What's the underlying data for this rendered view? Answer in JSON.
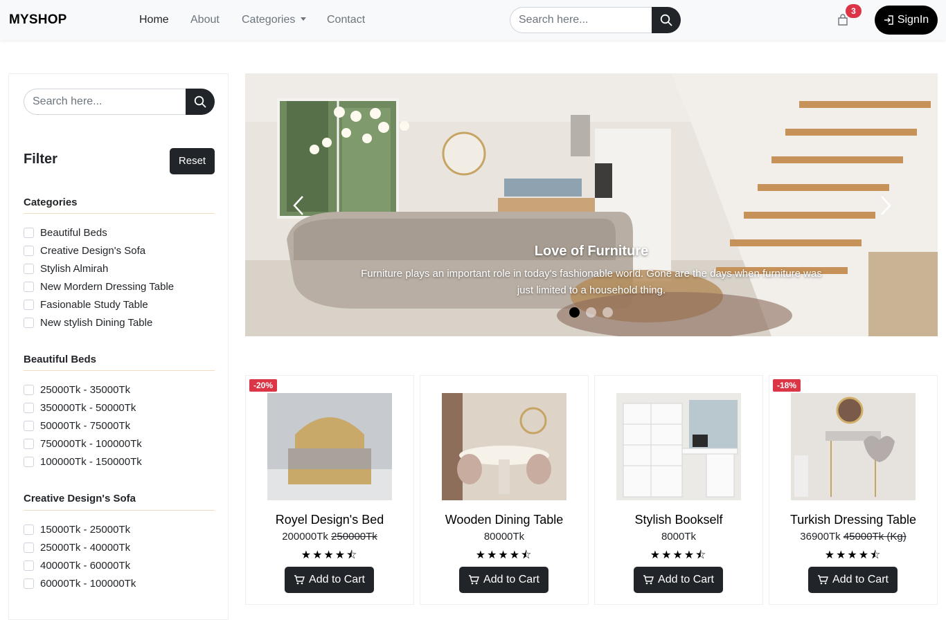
{
  "header": {
    "brand": "MYSHOP",
    "nav": [
      {
        "label": "Home"
      },
      {
        "label": "About"
      },
      {
        "label": "Categories"
      },
      {
        "label": "Contact"
      }
    ],
    "search_placeholder": "Search here...",
    "cart_count": "3",
    "signin_label": "SignIn"
  },
  "sidebar": {
    "search_placeholder": "Search here...",
    "filter_title": "Filter",
    "reset_label": "Reset",
    "sections": [
      {
        "title": "Categories",
        "items": [
          "Beautiful Beds",
          "Creative Design's Sofa",
          "Stylish Almirah",
          "New Mordern Dressing Table",
          "Fasionable Study Table",
          "New stylish Dining Table"
        ]
      },
      {
        "title": "Beautiful Beds",
        "items": [
          "25000Tk - 35000Tk",
          "350000Tk - 50000Tk",
          "50000Tk - 75000Tk",
          "750000Tk - 100000Tk",
          "100000Tk - 150000Tk"
        ]
      },
      {
        "title": "Creative Design's Sofa",
        "items": [
          "15000Tk - 25000Tk",
          "25000Tk - 40000Tk",
          "40000Tk - 60000Tk",
          "60000Tk - 100000Tk"
        ]
      }
    ]
  },
  "carousel": {
    "title": "Love of Furniture",
    "text": "Furniture plays an important role in today's fashionable world. Gone are the days when furniture was just limited to a household thing.",
    "active_slide": 1,
    "slide_count": 3
  },
  "products": [
    {
      "discount": "-20%",
      "name": "Royel Design's Bed",
      "price": "200000Tk",
      "old_price": "250000Tk",
      "rating": 4.5,
      "stars": "★★★★⯪",
      "cta": "Add to Cart"
    },
    {
      "discount": "",
      "name": "Wooden Dining Table",
      "price": "80000Tk",
      "old_price": "",
      "rating": 4.5,
      "stars": "★★★★⯪",
      "cta": "Add to Cart"
    },
    {
      "discount": "",
      "name": "Stylish Bookself",
      "price": "8000Tk",
      "old_price": "",
      "rating": 4.5,
      "stars": "★★★★⯪",
      "cta": "Add to Cart"
    },
    {
      "discount": "-18%",
      "name": "Turkish Dressing Table",
      "price": "36900Tk",
      "old_price": "45000Tk (Kg)",
      "rating": 4.5,
      "stars": "★★★★⯪",
      "cta": "Add to Cart"
    }
  ],
  "colors": {
    "dark": "#212529",
    "badge": "#dc3545",
    "divider": "#f0dcc2",
    "navbar_bg": "#f8f9fa"
  }
}
